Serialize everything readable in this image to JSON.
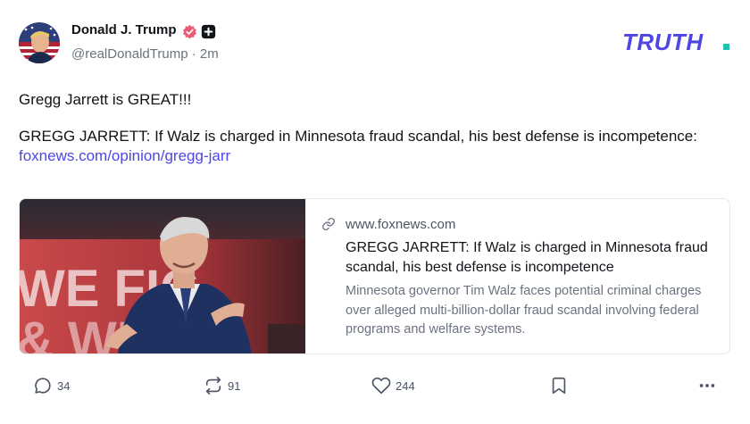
{
  "author": {
    "display_name": "Donald J. Trump",
    "handle": "@realDonaldTrump",
    "separator": "·",
    "time_ago": "2m",
    "badges": [
      "verified-badge-icon",
      "plus-badge-icon"
    ],
    "verified_color": "#e85d75"
  },
  "brand": {
    "logo_text": "TRUTH.",
    "logo_color": "#4f46e5",
    "dot_color": "#22c1b5"
  },
  "post": {
    "line1": "Gregg Jarrett is GREAT!!!",
    "line2": "GREGG JARRETT: If Walz is charged in Minnesota fraud scandal, his best defense is incompetence:",
    "link": "foxnews.com/opinion/gregg-jarr",
    "link_color": "#4f46e5"
  },
  "link_card": {
    "image_icon": "news-photo",
    "domain": "www.foxnews.com",
    "title": "GREGG JARRETT: If Walz is charged in Minnesota fraud scandal, his best defense is incompetence",
    "description": "Minnesota governor Tim Walz faces potential criminal charges over alleged multi-billion-dollar fraud scandal involving federal programs and welfare systems."
  },
  "actions": {
    "replies": "34",
    "retruths": "91",
    "likes": "244",
    "bookmark_icon": "bookmark-icon",
    "more_icon": "more-icon"
  }
}
